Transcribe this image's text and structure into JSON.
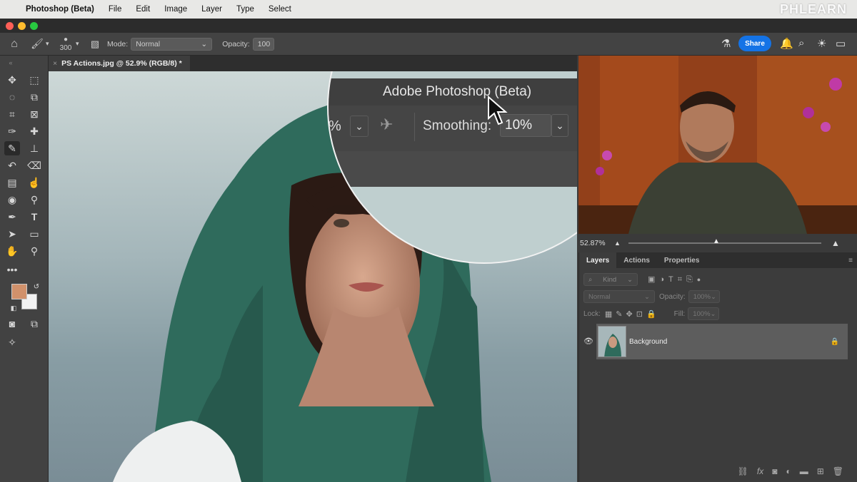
{
  "menubar": {
    "app": "Photoshop (Beta)",
    "items": [
      "File",
      "Edit",
      "Image",
      "Layer",
      "Type",
      "Select"
    ]
  },
  "brand": "PHLEARN",
  "options": {
    "brush_size": "300",
    "mode_label": "Mode:",
    "mode_value": "Normal",
    "opacity_label": "Opacity:",
    "opacity_value": "100",
    "share": "Share"
  },
  "document_tab": {
    "title": "PS Actions.jpg @ 52.9% (RGB/8) *"
  },
  "magnifier": {
    "title": "Adobe Photoshop (Beta)",
    "percent": "%",
    "smoothing_label": "Smoothing:",
    "smoothing_value": "10%"
  },
  "navigator": {
    "zoom": "52.87%"
  },
  "panels": {
    "tabs": [
      "Layers",
      "Actions",
      "Properties"
    ],
    "kind": "Kind",
    "blend_mode": "Normal",
    "opacity_label": "Opacity:",
    "opacity_value": "100%",
    "lock_label": "Lock:",
    "fill_label": "Fill:",
    "fill_value": "100%",
    "layer_name": "Background"
  },
  "colors": {
    "foreground": "#d1916b",
    "background": "#f2f2f2",
    "accent": "#1473e6"
  }
}
